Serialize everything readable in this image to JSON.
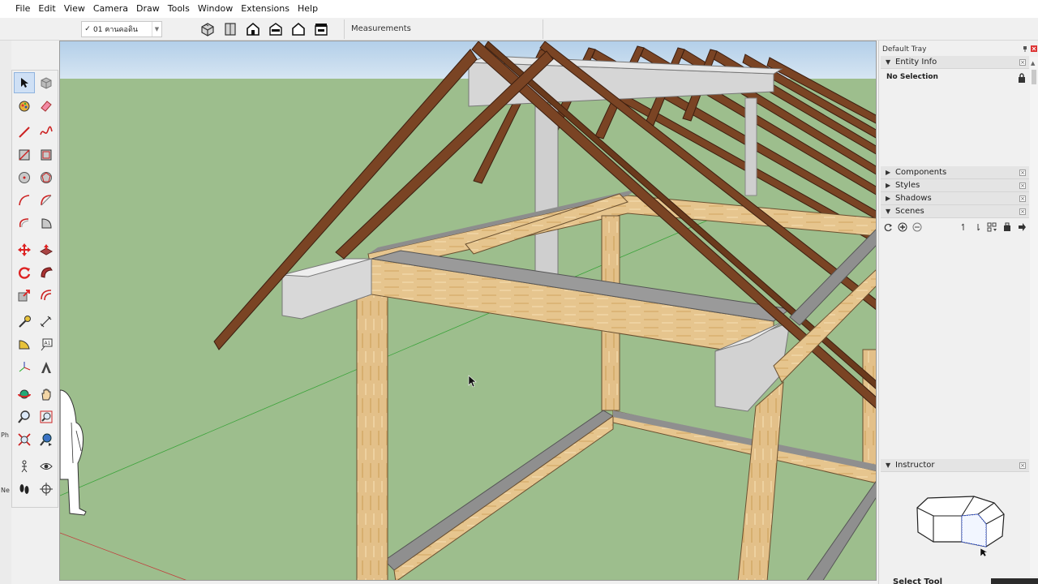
{
  "menu": [
    "File",
    "Edit",
    "View",
    "Camera",
    "Draw",
    "Tools",
    "Window",
    "Extensions",
    "Help"
  ],
  "toolbar": {
    "layer_value": "01 ฅานคอดิน",
    "view_buttons": [
      "iso-view-icon",
      "top-view-icon",
      "front-view-icon",
      "right-view-icon",
      "back-view-icon",
      "left-view-icon"
    ],
    "measurements_label": "Measurements"
  },
  "left_edge": {
    "text_1": "Ph",
    "text_2": "Ne"
  },
  "tools": [
    "select-tool-icon",
    "make-component-icon",
    "paint-bucket-icon",
    "eraser-icon",
    "line-tool-icon",
    "freehand-tool-icon",
    "rectangle-tool-icon",
    "rotated-rectangle-icon",
    "circle-tool-icon",
    "polygon-tool-icon",
    "arc-tool-icon",
    "two-point-arc-icon",
    "three-point-arc-icon",
    "pie-tool-icon",
    "move-tool-icon",
    "push-pull-icon",
    "rotate-tool-icon",
    "follow-me-icon",
    "scale-tool-icon",
    "offset-tool-icon",
    "tape-measure-icon",
    "dimension-tool-icon",
    "protractor-icon",
    "text-tool-icon",
    "axes-tool-icon",
    "3d-text-icon",
    "orbit-tool-icon",
    "pan-tool-icon",
    "zoom-tool-icon",
    "zoom-window-icon",
    "zoom-extents-icon",
    "previous-view-icon",
    "position-camera-icon",
    "look-around-icon",
    "walk-tool-icon",
    "section-plane-icon"
  ],
  "tray": {
    "title": "Default Tray",
    "entity_info": {
      "label": "Entity Info",
      "selection": "No Selection"
    },
    "components": "Components",
    "styles": "Styles",
    "shadows": "Shadows",
    "scenes": "Scenes",
    "instructor": {
      "label": "Instructor",
      "caption": "Select Tool"
    }
  },
  "colors": {
    "sky": "#b9d3ea",
    "ground": "#9dbe8d",
    "timber": "#e6c58e",
    "rafter": "#7a4424",
    "concrete": "#d6d6d6"
  }
}
